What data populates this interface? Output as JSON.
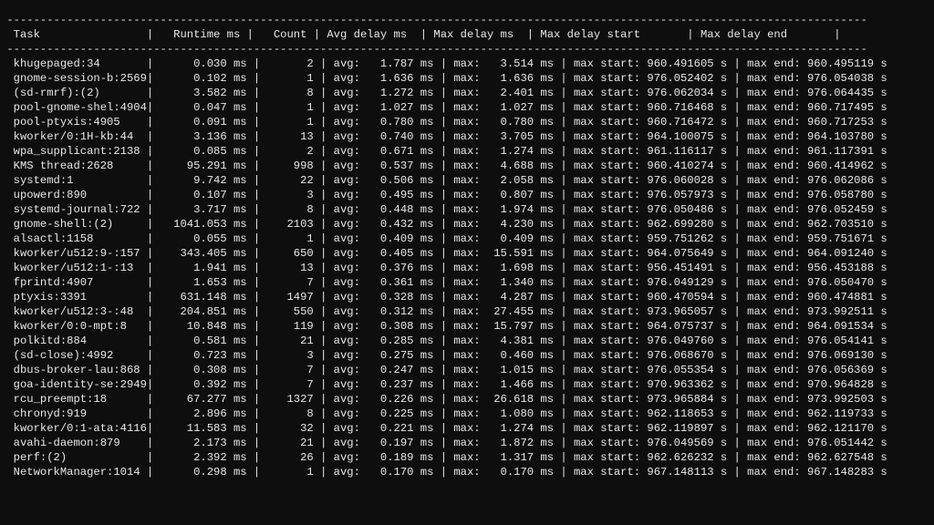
{
  "sep_char": "-",
  "sep_width": 129,
  "header": {
    "task": "Task",
    "runtime": "Runtime ms",
    "count": "Count",
    "avg": "Avg delay ms",
    "max": "Max delay ms",
    "max_start": "Max delay start",
    "max_end": "Max delay end"
  },
  "labels": {
    "avg": "avg:",
    "max": "max:",
    "max_start": "max start:",
    "max_end": "max end:",
    "ms": "ms",
    "s": "s"
  },
  "rows": [
    {
      "task": "khugepaged:34",
      "runtime": "0.030",
      "count": "2",
      "avg": "1.787",
      "max": "3.514",
      "max_start": "960.491605",
      "max_end": "960.495119"
    },
    {
      "task": "gnome-session-b:2569",
      "runtime": "0.102",
      "count": "1",
      "avg": "1.636",
      "max": "1.636",
      "max_start": "976.052402",
      "max_end": "976.054038"
    },
    {
      "task": "(sd-rmrf):(2)",
      "runtime": "3.582",
      "count": "8",
      "avg": "1.272",
      "max": "2.401",
      "max_start": "976.062034",
      "max_end": "976.064435"
    },
    {
      "task": "pool-gnome-shel:4904",
      "runtime": "0.047",
      "count": "1",
      "avg": "1.027",
      "max": "1.027",
      "max_start": "960.716468",
      "max_end": "960.717495"
    },
    {
      "task": "pool-ptyxis:4905",
      "runtime": "0.091",
      "count": "1",
      "avg": "0.780",
      "max": "0.780",
      "max_start": "960.716472",
      "max_end": "960.717253"
    },
    {
      "task": "kworker/0:1H-kb:44",
      "runtime": "3.136",
      "count": "13",
      "avg": "0.740",
      "max": "3.705",
      "max_start": "964.100075",
      "max_end": "964.103780"
    },
    {
      "task": "wpa_supplicant:2138",
      "runtime": "0.085",
      "count": "2",
      "avg": "0.671",
      "max": "1.274",
      "max_start": "961.116117",
      "max_end": "961.117391"
    },
    {
      "task": "KMS thread:2628",
      "runtime": "95.291",
      "count": "998",
      "avg": "0.537",
      "max": "4.688",
      "max_start": "960.410274",
      "max_end": "960.414962"
    },
    {
      "task": "systemd:1",
      "runtime": "9.742",
      "count": "22",
      "avg": "0.506",
      "max": "2.058",
      "max_start": "976.060028",
      "max_end": "976.062086"
    },
    {
      "task": "upowerd:890",
      "runtime": "0.107",
      "count": "3",
      "avg": "0.495",
      "max": "0.807",
      "max_start": "976.057973",
      "max_end": "976.058780"
    },
    {
      "task": "systemd-journal:722",
      "runtime": "3.717",
      "count": "8",
      "avg": "0.448",
      "max": "1.974",
      "max_start": "976.050486",
      "max_end": "976.052459"
    },
    {
      "task": "gnome-shell:(2)",
      "runtime": "1041.053",
      "count": "2103",
      "avg": "0.432",
      "max": "4.230",
      "max_start": "962.699280",
      "max_end": "962.703510"
    },
    {
      "task": "alsactl:1158",
      "runtime": "0.055",
      "count": "1",
      "avg": "0.409",
      "max": "0.409",
      "max_start": "959.751262",
      "max_end": "959.751671"
    },
    {
      "task": "kworker/u512:9-:157",
      "runtime": "343.405",
      "count": "650",
      "avg": "0.405",
      "max": "15.591",
      "max_start": "964.075649",
      "max_end": "964.091240"
    },
    {
      "task": "kworker/u512:1-:13",
      "runtime": "1.941",
      "count": "13",
      "avg": "0.376",
      "max": "1.698",
      "max_start": "956.451491",
      "max_end": "956.453188"
    },
    {
      "task": "fprintd:4907",
      "runtime": "1.653",
      "count": "7",
      "avg": "0.361",
      "max": "1.340",
      "max_start": "976.049129",
      "max_end": "976.050470"
    },
    {
      "task": "ptyxis:3391",
      "runtime": "631.148",
      "count": "1497",
      "avg": "0.328",
      "max": "4.287",
      "max_start": "960.470594",
      "max_end": "960.474881"
    },
    {
      "task": "kworker/u512:3-:48",
      "runtime": "204.851",
      "count": "550",
      "avg": "0.312",
      "max": "27.455",
      "max_start": "973.965057",
      "max_end": "973.992511"
    },
    {
      "task": "kworker/0:0-mpt:8",
      "runtime": "10.848",
      "count": "119",
      "avg": "0.308",
      "max": "15.797",
      "max_start": "964.075737",
      "max_end": "964.091534"
    },
    {
      "task": "polkitd:884",
      "runtime": "0.581",
      "count": "21",
      "avg": "0.285",
      "max": "4.381",
      "max_start": "976.049760",
      "max_end": "976.054141"
    },
    {
      "task": "(sd-close):4992",
      "runtime": "0.723",
      "count": "3",
      "avg": "0.275",
      "max": "0.460",
      "max_start": "976.068670",
      "max_end": "976.069130"
    },
    {
      "task": "dbus-broker-lau:868",
      "runtime": "0.308",
      "count": "7",
      "avg": "0.247",
      "max": "1.015",
      "max_start": "976.055354",
      "max_end": "976.056369"
    },
    {
      "task": "goa-identity-se:2949",
      "runtime": "0.392",
      "count": "7",
      "avg": "0.237",
      "max": "1.466",
      "max_start": "970.963362",
      "max_end": "970.964828"
    },
    {
      "task": "rcu_preempt:18",
      "runtime": "67.277",
      "count": "1327",
      "avg": "0.226",
      "max": "26.618",
      "max_start": "973.965884",
      "max_end": "973.992503"
    },
    {
      "task": "chronyd:919",
      "runtime": "2.896",
      "count": "8",
      "avg": "0.225",
      "max": "1.080",
      "max_start": "962.118653",
      "max_end": "962.119733"
    },
    {
      "task": "kworker/0:1-ata:4116",
      "runtime": "11.583",
      "count": "32",
      "avg": "0.221",
      "max": "1.274",
      "max_start": "962.119897",
      "max_end": "962.121170"
    },
    {
      "task": "avahi-daemon:879",
      "runtime": "2.173",
      "count": "21",
      "avg": "0.197",
      "max": "1.872",
      "max_start": "976.049569",
      "max_end": "976.051442"
    },
    {
      "task": "perf:(2)",
      "runtime": "2.392",
      "count": "26",
      "avg": "0.189",
      "max": "1.317",
      "max_start": "962.626232",
      "max_end": "962.627548"
    },
    {
      "task": "NetworkManager:1014",
      "runtime": "0.298",
      "count": "1",
      "avg": "0.170",
      "max": "0.170",
      "max_start": "967.148113",
      "max_end": "967.148283"
    }
  ]
}
